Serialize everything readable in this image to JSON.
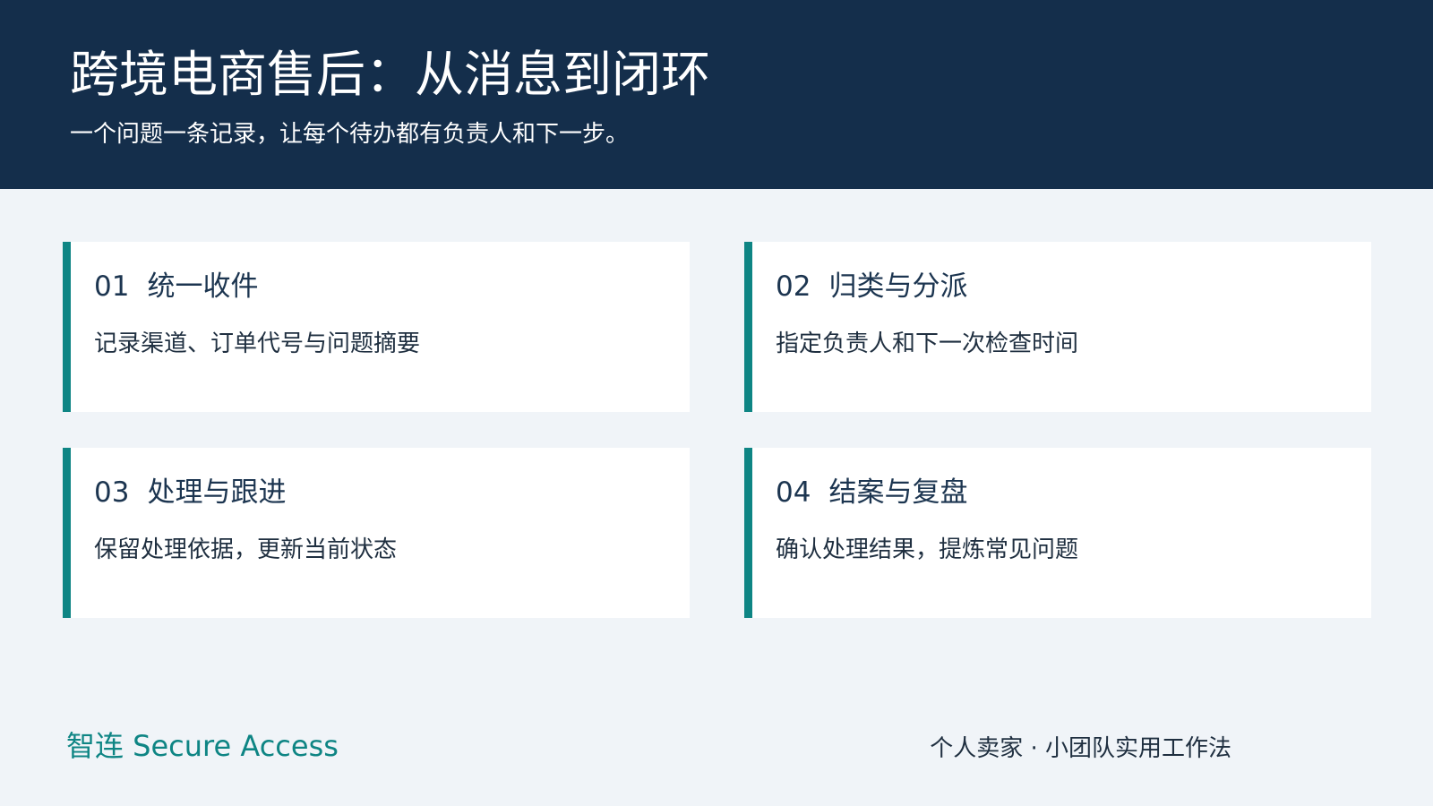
{
  "header": {
    "title": "跨境电商售后：从消息到闭环",
    "subtitle": "一个问题一条记录，让每个待办都有负责人和下一步。"
  },
  "cards": [
    {
      "number": "01",
      "title": "统一收件",
      "description": "记录渠道、订单代号与问题摘要"
    },
    {
      "number": "02",
      "title": "归类与分派",
      "description": "指定负责人和下一次检查时间"
    },
    {
      "number": "03",
      "title": "处理与跟进",
      "description": "保留处理依据，更新当前状态"
    },
    {
      "number": "04",
      "title": "结案与复盘",
      "description": "确认处理结果，提炼常见问题"
    }
  ],
  "footer": {
    "brand": "智连 Secure Access",
    "tagline": "个人卖家 · 小团队实用工作法"
  },
  "colors": {
    "header_bg": "#142e4b",
    "accent": "#0e8584",
    "page_bg": "#f0f4f8"
  }
}
